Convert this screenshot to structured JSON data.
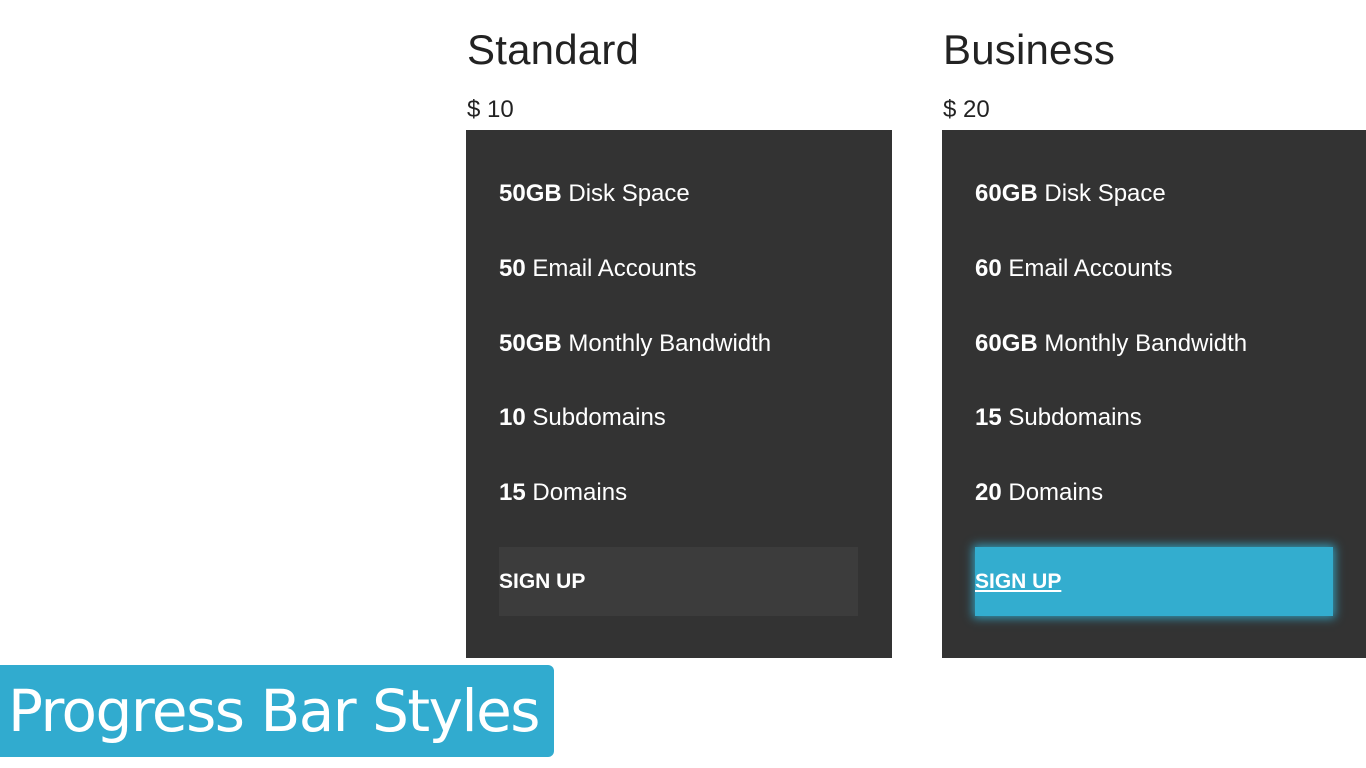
{
  "plans": [
    {
      "title": "Standard",
      "price": "$ 10",
      "features": [
        {
          "value": "50GB",
          "label": " Disk Space"
        },
        {
          "value": "50",
          "label": " Email Accounts"
        },
        {
          "value": "50GB",
          "label": " Monthly Bandwidth"
        },
        {
          "value": "10",
          "label": " Subdomains"
        },
        {
          "value": "15",
          "label": " Domains"
        }
      ],
      "button_label": "SIGN UP"
    },
    {
      "title": "Business",
      "price": "$ 20",
      "features": [
        {
          "value": "60GB",
          "label": " Disk Space"
        },
        {
          "value": "60",
          "label": " Email Accounts"
        },
        {
          "value": "60GB",
          "label": " Monthly Bandwidth"
        },
        {
          "value": "15",
          "label": " Subdomains"
        },
        {
          "value": "20",
          "label": " Domains"
        }
      ],
      "button_label": "SIGN UP"
    }
  ],
  "banner": {
    "text": "Progress Bar Styles"
  },
  "colors": {
    "card_background": "#333333",
    "button_default": "#3c3c3c",
    "button_active": "#33adcf",
    "banner_background": "#31abcf"
  }
}
